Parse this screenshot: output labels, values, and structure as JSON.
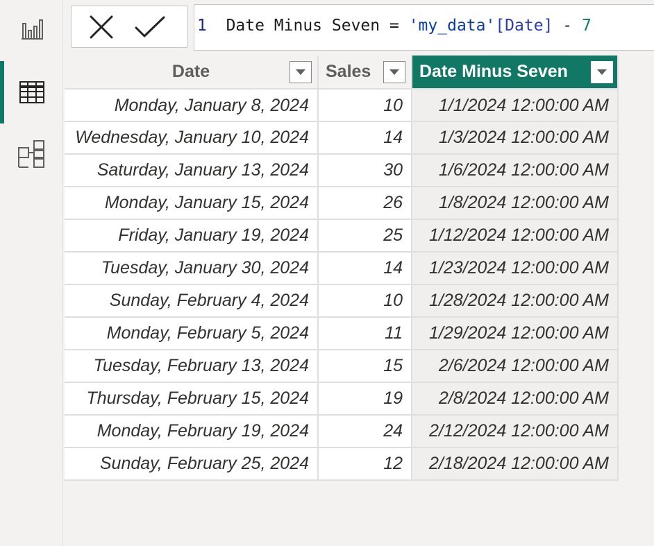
{
  "formula_bar": {
    "line_number": "1",
    "measure_name": "Date Minus Seven",
    "operator_eq": "=",
    "table_ref": "'my_data'",
    "column_ref": "[Date]",
    "operator_minus": "-",
    "constant": "7"
  },
  "table": {
    "headers": {
      "date": "Date",
      "sales": "Sales",
      "date_minus_seven": "Date Minus Seven"
    },
    "rows": [
      {
        "date": "Monday, January 8, 2024",
        "sales": "10",
        "minus7": "1/1/2024 12:00:00 AM"
      },
      {
        "date": "Wednesday, January 10, 2024",
        "sales": "14",
        "minus7": "1/3/2024 12:00:00 AM"
      },
      {
        "date": "Saturday, January 13, 2024",
        "sales": "30",
        "minus7": "1/6/2024 12:00:00 AM"
      },
      {
        "date": "Monday, January 15, 2024",
        "sales": "26",
        "minus7": "1/8/2024 12:00:00 AM"
      },
      {
        "date": "Friday, January 19, 2024",
        "sales": "25",
        "minus7": "1/12/2024 12:00:00 AM"
      },
      {
        "date": "Tuesday, January 30, 2024",
        "sales": "14",
        "minus7": "1/23/2024 12:00:00 AM"
      },
      {
        "date": "Sunday, February 4, 2024",
        "sales": "10",
        "minus7": "1/28/2024 12:00:00 AM"
      },
      {
        "date": "Monday, February 5, 2024",
        "sales": "11",
        "minus7": "1/29/2024 12:00:00 AM"
      },
      {
        "date": "Tuesday, February 13, 2024",
        "sales": "15",
        "minus7": "2/6/2024 12:00:00 AM"
      },
      {
        "date": "Thursday, February 15, 2024",
        "sales": "19",
        "minus7": "2/8/2024 12:00:00 AM"
      },
      {
        "date": "Monday, February 19, 2024",
        "sales": "24",
        "minus7": "2/12/2024 12:00:00 AM"
      },
      {
        "date": "Sunday, February 25, 2024",
        "sales": "12",
        "minus7": "2/18/2024 12:00:00 AM"
      }
    ]
  },
  "icons": {
    "rail": [
      "report-view-icon",
      "table-view-icon",
      "model-view-icon"
    ],
    "formula": [
      "cancel-icon",
      "commit-icon"
    ],
    "header": "filter-dropdown-icon"
  },
  "colors": {
    "accent": "#117865"
  }
}
